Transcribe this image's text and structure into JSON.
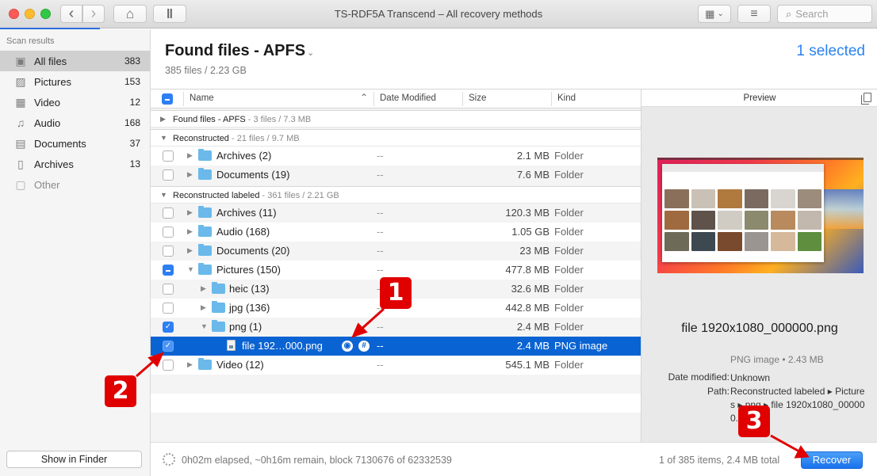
{
  "window": {
    "title": "TS-RDF5A Transcend – All recovery methods",
    "search_placeholder": "Search",
    "scan_progress": 0.114
  },
  "toolbar": {
    "back_icon": "‹",
    "forward_icon": "›",
    "home_icon": "⌂",
    "pause_icon": "‖",
    "view_icon": "▦",
    "view_chevron": "⌄",
    "filter_icon": "≡",
    "search_icon": "⌕"
  },
  "sidebar": {
    "header": "Scan results",
    "items": [
      {
        "label": "All files",
        "count": "383",
        "icon": "▣"
      },
      {
        "label": "Pictures",
        "count": "153",
        "icon": "▨"
      },
      {
        "label": "Video",
        "count": "12",
        "icon": "▦"
      },
      {
        "label": "Audio",
        "count": "168",
        "icon": "♫"
      },
      {
        "label": "Documents",
        "count": "37",
        "icon": "▤"
      },
      {
        "label": "Archives",
        "count": "13",
        "icon": "▯"
      },
      {
        "label": "Other",
        "count": "",
        "icon": "▢"
      }
    ],
    "show_in_finder": "Show in Finder"
  },
  "main": {
    "title": "Found files - APFS",
    "title_chevron": "⌄",
    "subtitle": "385 files / 2.23 GB",
    "selected": "1 selected"
  },
  "table": {
    "columns": {
      "name": "Name",
      "sort_icon": "⌃",
      "date": "Date Modified",
      "size": "Size",
      "kind": "Kind"
    },
    "groups": [
      {
        "name": "Found files - APFS",
        "meta": " - 3 files / 7.3 MB",
        "expanded": false
      },
      {
        "name": "Reconstructed",
        "meta": " - 21 files / 9.7 MB",
        "expanded": true
      },
      {
        "name": "Reconstructed labeled",
        "meta": " - 361 files / 2.21 GB",
        "expanded": true
      }
    ],
    "rows": [
      {
        "name": "Archives (2)",
        "date": "--",
        "size": "2.1 MB",
        "kind": "Folder",
        "checked": "off"
      },
      {
        "name": "Documents (19)",
        "date": "--",
        "size": "7.6 MB",
        "kind": "Folder",
        "checked": "off"
      },
      {
        "name": "Archives (11)",
        "date": "--",
        "size": "120.3 MB",
        "kind": "Folder",
        "checked": "off"
      },
      {
        "name": "Audio (168)",
        "date": "--",
        "size": "1.05 GB",
        "kind": "Folder",
        "checked": "off"
      },
      {
        "name": "Documents (20)",
        "date": "--",
        "size": "23 MB",
        "kind": "Folder",
        "checked": "off"
      },
      {
        "name": "Pictures (150)",
        "date": "--",
        "size": "477.8 MB",
        "kind": "Folder",
        "checked": "mixed"
      },
      {
        "name": "heic (13)",
        "date": "--",
        "size": "32.6 MB",
        "kind": "Folder",
        "checked": "off"
      },
      {
        "name": "jpg (136)",
        "date": "--",
        "size": "442.8 MB",
        "kind": "Folder",
        "checked": "off"
      },
      {
        "name": "png (1)",
        "date": "--",
        "size": "2.4 MB",
        "kind": "Folder",
        "checked": "on"
      },
      {
        "name": "file 192…000.png",
        "date": "--",
        "size": "2.4 MB",
        "kind": "PNG image",
        "checked": "on"
      },
      {
        "name": "Video (12)",
        "date": "--",
        "size": "545.1 MB",
        "kind": "Folder",
        "checked": "off"
      }
    ],
    "tri_right": "▶",
    "tri_down": "▼",
    "check_mark": "✓",
    "eye_icon": "◉",
    "hash_icon": "#"
  },
  "preview": {
    "header": "Preview",
    "file_name": "file 1920x1080_000000.png",
    "kind_size": "PNG image • 2.43 MB",
    "date_label": "Date modified:",
    "date_value": "Unknown",
    "path_label": "Path:",
    "path_value": "Reconstructed labeled ▸ Pictures ▸ png ▸ file 1920x1080_000000.png"
  },
  "status": {
    "progress_text": "0h02m elapsed, ~0h16m remain, block 7130676 of 62332539",
    "total_text": "1 of 385 items, 2.4 MB total",
    "recover": "Recover"
  },
  "annotations": {
    "one": "1",
    "two": "2",
    "three": "3",
    "color": "#e10000"
  }
}
